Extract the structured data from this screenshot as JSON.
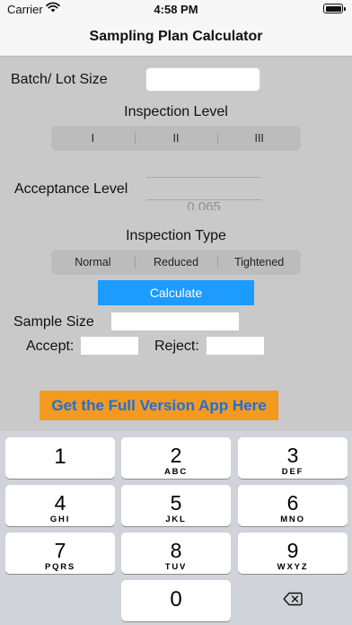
{
  "status_bar": {
    "carrier": "Carrier",
    "time": "4:58 PM"
  },
  "nav": {
    "title": "Sampling Plan Calculator"
  },
  "form": {
    "batch_label": "Batch/ Lot Size",
    "batch_value": "",
    "inspection_level": {
      "label": "Inspection Level",
      "options": [
        "I",
        "II",
        "III"
      ]
    },
    "acceptance_label": "Acceptance Level",
    "acceptance_picker_value": "0.065",
    "inspection_type": {
      "label": "Inspection Type",
      "options": [
        "Normal",
        "Reduced",
        "Tightened"
      ]
    },
    "calculate_label": "Calculate",
    "sample_size_label": "Sample Size",
    "sample_size_value": "",
    "accept_label": "Accept:",
    "accept_value": "",
    "reject_label": "Reject:",
    "reject_value": ""
  },
  "promo": {
    "label": "Get the Full Version App Here"
  },
  "keyboard": {
    "keys": [
      {
        "digit": "1",
        "letters": ""
      },
      {
        "digit": "2",
        "letters": "ABC"
      },
      {
        "digit": "3",
        "letters": "DEF"
      },
      {
        "digit": "4",
        "letters": "GHI"
      },
      {
        "digit": "5",
        "letters": "JKL"
      },
      {
        "digit": "6",
        "letters": "MNO"
      },
      {
        "digit": "7",
        "letters": "PQRS"
      },
      {
        "digit": "8",
        "letters": "TUV"
      },
      {
        "digit": "9",
        "letters": "WXYZ"
      },
      {
        "digit": "0",
        "letters": ""
      }
    ],
    "backspace_icon": "backspace-icon"
  }
}
